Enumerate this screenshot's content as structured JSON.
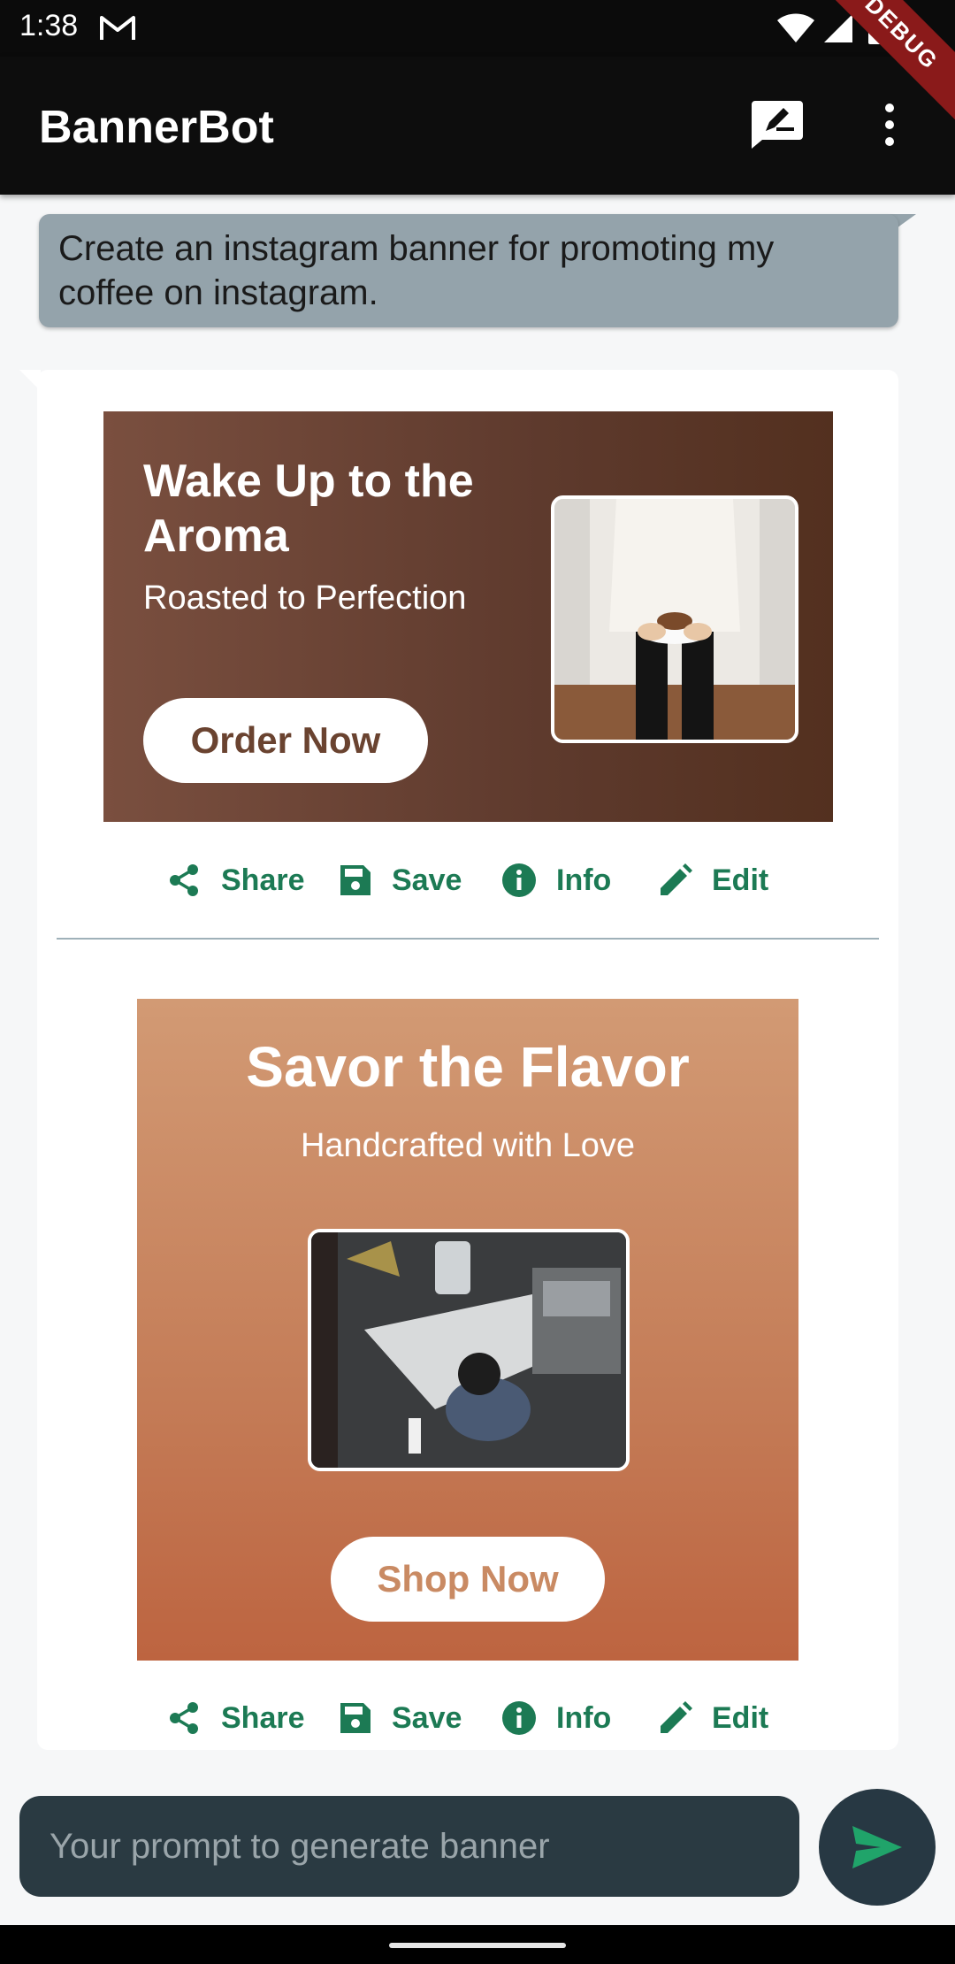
{
  "status_bar": {
    "time": "1:38"
  },
  "app_bar": {
    "title": "BannerBot",
    "debug_label": "DEBUG"
  },
  "chat": {
    "user_message": "Create an instagram banner for promoting my coffee on instagram.",
    "banners": [
      {
        "title": "Wake Up to the Aroma",
        "subtitle": "Roasted to Perfection",
        "cta": "Order Now",
        "colors": {
          "from": "#7a4f3f",
          "to": "#53301f",
          "cta_text": "#6a4330"
        }
      },
      {
        "title": "Savor the Flavor",
        "subtitle": "Handcrafted with Love",
        "cta": "Shop Now",
        "colors": {
          "from": "#d29a74",
          "to": "#bd6440",
          "cta_text": "#c98a63"
        }
      }
    ],
    "actions": {
      "share": "Share",
      "save": "Save",
      "info": "Info",
      "edit": "Edit"
    }
  },
  "input": {
    "placeholder": "Your prompt to generate banner"
  },
  "accent_color": "#1c7a54"
}
